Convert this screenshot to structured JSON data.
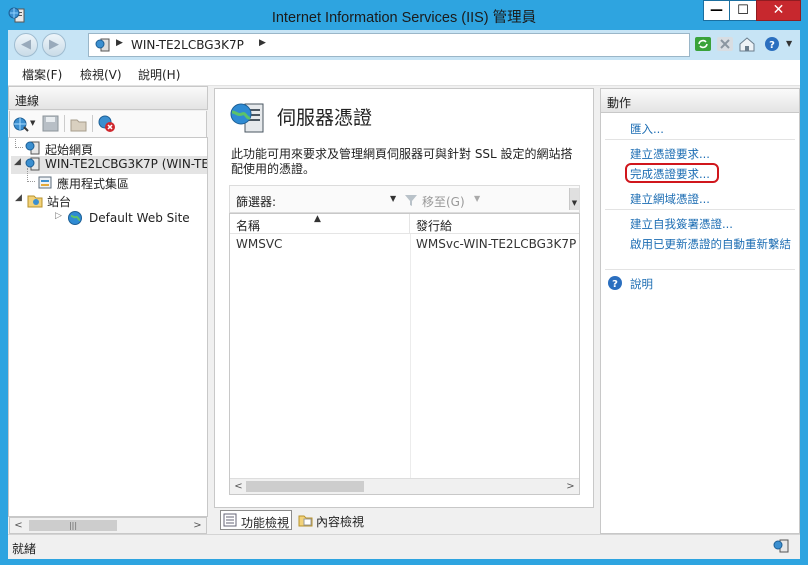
{
  "window": {
    "title": "Internet Information Services (IIS) 管理員",
    "min_glyph": "—",
    "max_glyph": "☐",
    "close_glyph": "✕"
  },
  "address": {
    "crumb": "WIN-TE2LCBG3K7P",
    "separator": "▶"
  },
  "menu": {
    "items": [
      "檔案(F)",
      "檢視(V)",
      "說明(H)"
    ]
  },
  "connections": {
    "header": "連線",
    "tree": [
      {
        "label": "起始網頁",
        "icon": "home-server-icon"
      },
      {
        "label": "WIN-TE2LCBG3K7P (WIN-TE",
        "icon": "server-icon"
      },
      {
        "label": "應用程式集區",
        "icon": "app-pool-icon"
      },
      {
        "label": "站台",
        "icon": "sites-folder-icon"
      },
      {
        "label": "Default Web Site",
        "icon": "globe-icon"
      }
    ]
  },
  "feature": {
    "title": "伺服器憑證",
    "description": "此功能可用來要求及管理網頁伺服器可與針對 SSL 設定的網站搭配使用的憑證。",
    "filter_label": "篩選器:",
    "go_label": "移至(G)",
    "columns": [
      "名稱",
      "發行給"
    ],
    "rows": [
      {
        "name": "WMSVC",
        "issued_to": "WMSvc-WIN-TE2LCBG3K7P"
      }
    ],
    "view_tabs": [
      "功能檢視",
      "內容檢視"
    ]
  },
  "actions": {
    "header": "動作",
    "items": [
      "匯入...",
      "建立憑證要求...",
      "完成憑證要求...",
      "建立網域憑證...",
      "建立自我簽署憑證...",
      "啟用已更新憑證的自動重新繫結",
      "說明"
    ],
    "highlighted": "完成憑證要求...",
    "highlight_color": "#d0161c"
  },
  "status": {
    "text": "就緒"
  },
  "colors": {
    "window_frame": "#2ea4e0",
    "link": "#1c6db3"
  }
}
